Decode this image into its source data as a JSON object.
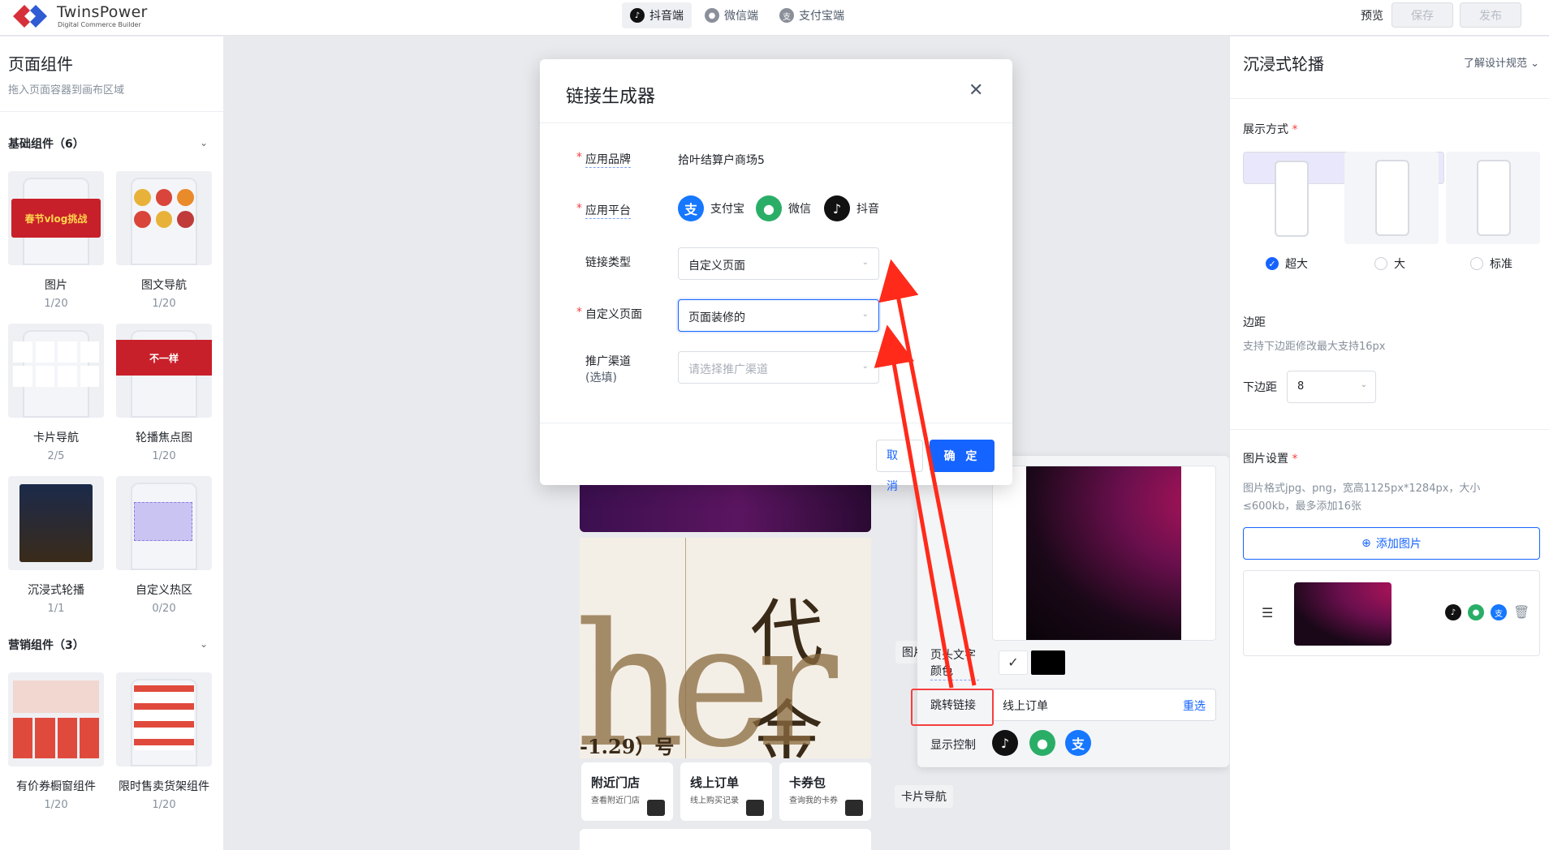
{
  "topbar": {
    "logo_name": "TwinsPower",
    "logo_sub": "Digital Commerce Builder",
    "platforms": [
      {
        "label": "抖音端",
        "icon": "tiktok-icon",
        "active": true
      },
      {
        "label": "微信端",
        "icon": "wechat-icon",
        "active": false
      },
      {
        "label": "支付宝端",
        "icon": "alipay-icon",
        "active": false
      }
    ],
    "preview": "预览",
    "save": "保存",
    "publish": "发布"
  },
  "left_panel": {
    "title": "页面组件",
    "subtitle": "拖入页面容器到画布区域",
    "groups": [
      {
        "title": "基础组件（6）",
        "items": [
          {
            "name": "图片",
            "count": "1/20"
          },
          {
            "name": "图文导航",
            "count": "1/20"
          },
          {
            "name": "卡片导航",
            "count": "2/5"
          },
          {
            "name": "轮播焦点图",
            "count": "1/20"
          },
          {
            "name": "沉浸式轮播",
            "count": "1/1"
          },
          {
            "name": "自定义热区",
            "count": "0/20"
          }
        ]
      },
      {
        "title": "营销组件（3）",
        "items": [
          {
            "name": "有价券橱窗组件",
            "count": "1/20"
          },
          {
            "name": "限时售卖货架组件",
            "count": "1/20"
          }
        ]
      }
    ],
    "thumb_texts": {
      "poster": "春节vlog挑战",
      "banner": "不一样"
    }
  },
  "canvas": {
    "poster_date": "-1.29）号",
    "poster_chars": [
      "代",
      "金"
    ],
    "poster_latin": "her",
    "cards": [
      {
        "title": "附近门店",
        "sub": "查看附近门店"
      },
      {
        "title": "线上订单",
        "sub": "线上购买记录"
      },
      {
        "title": "卡券包",
        "sub": "查询我的卡券"
      }
    ],
    "tag_image": "图片",
    "tag_card_nav": "卡片导航"
  },
  "popover": {
    "header_color_label": "页头文字颜色",
    "check_mark": "✓",
    "jump_link_label": "跳转链接",
    "jump_link_value": "线上订单",
    "reselect": "重选",
    "display_label": "显示控制"
  },
  "right_panel": {
    "title": "沉浸式轮播",
    "design_link": "了解设计规范",
    "display_mode_label": "展示方式",
    "modes": [
      {
        "label": "超大",
        "selected": true
      },
      {
        "label": "大",
        "selected": false
      },
      {
        "label": "标准",
        "selected": false
      }
    ],
    "margin_label": "边距",
    "margin_desc": "支持下边距修改最大支持16px",
    "bottom_margin_label": "下边距",
    "bottom_margin_value": "8",
    "image_settings_label": "图片设置",
    "image_desc_1": "图片格式jpg、png，宽高1125px*1284px，大小",
    "image_desc_2": "≤600kb，最多添加16张",
    "add_image": "添加图片"
  },
  "modal": {
    "title": "链接生成器",
    "brand_label": "应用品牌",
    "brand_value": "拾叶结算户商场5",
    "platform_label": "应用平台",
    "platforms": [
      {
        "label": "支付宝",
        "icon": "alipay-icon"
      },
      {
        "label": "微信",
        "icon": "wechat-icon"
      },
      {
        "label": "抖音",
        "icon": "tiktok-icon"
      }
    ],
    "link_type_label": "链接类型",
    "link_type_value": "自定义页面",
    "custom_page_label": "自定义页面",
    "custom_page_value": "页面装修的",
    "channel_label": "推广渠道",
    "channel_optional": "(选填)",
    "channel_placeholder": "请选择推广渠道",
    "cancel": "取 消",
    "ok": "确 定"
  },
  "colors": {
    "primary": "#1664ff",
    "danger": "#f53f3f",
    "alipay": "#1677ff",
    "wechat": "#2aae67",
    "tiktok": "#111111"
  }
}
